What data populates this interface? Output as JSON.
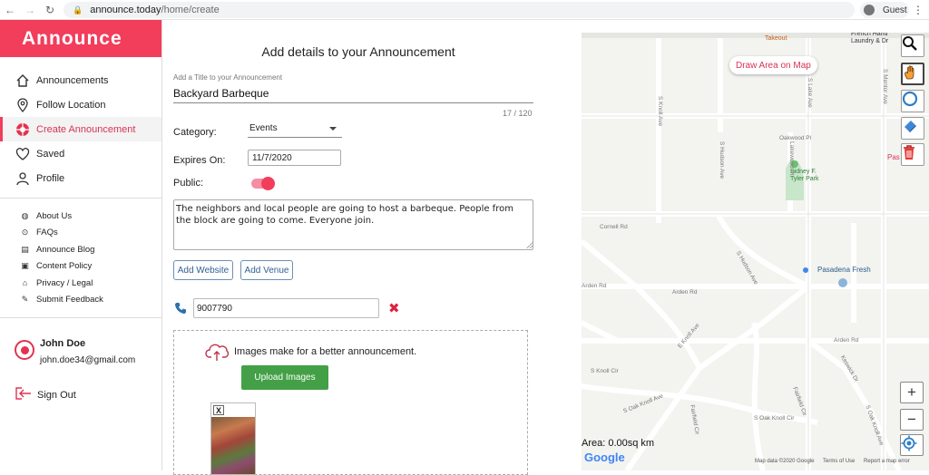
{
  "browser": {
    "url_host": "announce.today",
    "url_path": "/home/create",
    "profile": "Guest"
  },
  "sidebar": {
    "logo": "Announce",
    "main_items": [
      {
        "label": "Announcements",
        "icon": "home-icon"
      },
      {
        "label": "Follow Location",
        "icon": "location-pin-icon"
      },
      {
        "label": "Create Announcement",
        "icon": "create-icon",
        "active": true
      },
      {
        "label": "Saved",
        "icon": "heart-icon"
      },
      {
        "label": "Profile",
        "icon": "person-icon"
      }
    ],
    "sub_items": [
      {
        "label": "About Us",
        "icon": "globe-icon"
      },
      {
        "label": "FAQs",
        "icon": "question-icon"
      },
      {
        "label": "Announce Blog",
        "icon": "blog-icon"
      },
      {
        "label": "Content Policy",
        "icon": "policy-icon"
      },
      {
        "label": "Privacy / Legal",
        "icon": "lock-icon"
      },
      {
        "label": "Submit Feedback",
        "icon": "feedback-icon"
      }
    ],
    "user": {
      "name": "John Doe",
      "email": "john.doe34@gmail.com"
    },
    "sign_out": "Sign Out"
  },
  "form": {
    "heading": "Add details to your Announcement",
    "title_label": "Add a Title to your Announcement",
    "title_value": "Backyard Barbeque",
    "title_counter": "17 / 120",
    "category_label": "Category:",
    "category_value": "Events",
    "expires_label": "Expires On:",
    "expires_value": "11/7/2020",
    "public_label": "Public:",
    "public_on": true,
    "description": "The neighbors and local people are going to host a barbeque. People from the block are going to come. Everyone join.",
    "add_website": "Add Website",
    "add_venue": "Add Venue",
    "phone_value": "9007790",
    "remove_glyph": "✖",
    "images_prompt": "Images make for a better announcement.",
    "upload_button": "Upload Images",
    "thumb_close": "X"
  },
  "map": {
    "draw_area_button": "Draw Area on Map",
    "area_readout": "Area: 0.00sq km",
    "google_logo": "Google",
    "footer": [
      "Map data ©2020 Google",
      "Terms of Use",
      "Report a map error"
    ],
    "zoom_in": "+",
    "zoom_out": "−",
    "pois": {
      "takeout": "Takeout",
      "french_hand": "French Hand\nLaundry & Dr",
      "park": "Sidney F.\nTyler Park",
      "pasadena_fresh": "Pasadena Fresh",
      "pas": "Pas"
    },
    "streets": [
      "S Lake Ave",
      "S Mentor Ave",
      "S Knoll Ave",
      "S Hudson Ave",
      "Lakewood Pl",
      "Oakwood Pl",
      "Cornell Rd",
      "Arden Rd",
      "S Hudson Ave",
      "E Knoll Ave",
      "S Knoll Cir",
      "S Oak Knoll Ave",
      "S Oak Knoll Cir",
      "Fairfield Cir",
      "Keswick Dr",
      "Fairfield Cir",
      "S Oak Knoll Ave"
    ]
  }
}
